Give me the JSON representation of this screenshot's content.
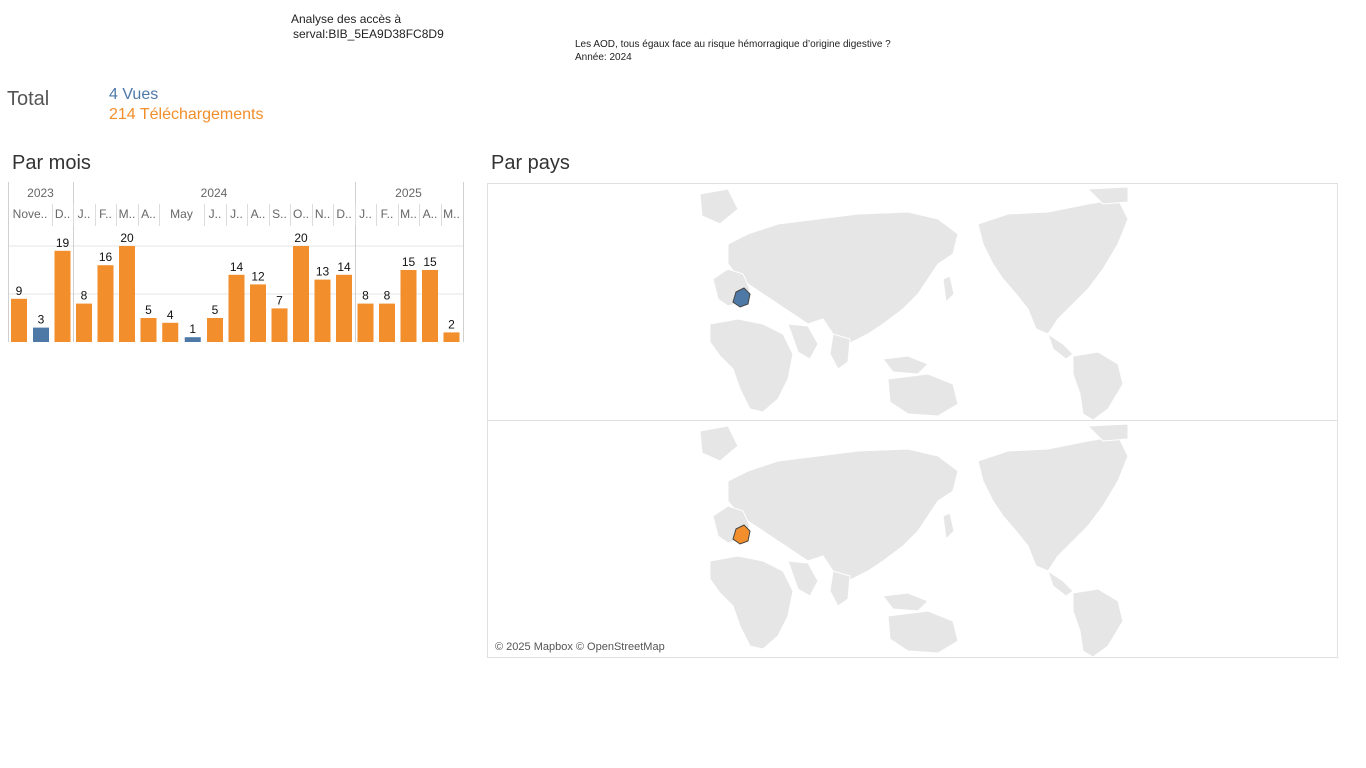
{
  "header": {
    "title_line1": "Analyse des accès à",
    "title_line2": "serval:BIB_5EA9D38FC8D9",
    "doc_title": "Les AOD, tous égaux face au risque hémorragique d’origine digestive ?",
    "doc_year": "Année: 2024"
  },
  "totals": {
    "label": "Total",
    "views": "4 Vues",
    "downloads": "214 Téléchargements"
  },
  "sections": {
    "by_month": "Par mois",
    "by_country": "Par pays"
  },
  "colors": {
    "views": "#4e79a7",
    "downloads": "#f28e2b",
    "grid": "#e6e6e6",
    "header_text": "#666666"
  },
  "chart_data": {
    "type": "bar",
    "title": "Par mois",
    "years": [
      {
        "label": "2023",
        "span": 2
      },
      {
        "label": "2024",
        "span": 12
      },
      {
        "label": "2025",
        "span": 5
      }
    ],
    "month_labels": [
      "Nove..",
      "D..",
      "J..",
      "F..",
      "M..",
      "A..",
      "May",
      "J..",
      "J..",
      "A..",
      "S..",
      "O..",
      "N..",
      "D..",
      "J..",
      "F..",
      "M..",
      "A..",
      "M.."
    ],
    "months": [
      {
        "bars": [
          {
            "series": "downloads",
            "value": 9
          },
          {
            "series": "views",
            "value": 3
          }
        ]
      },
      {
        "bars": [
          {
            "series": "downloads",
            "value": 19
          }
        ]
      },
      {
        "bars": [
          {
            "series": "downloads",
            "value": 8
          }
        ]
      },
      {
        "bars": [
          {
            "series": "downloads",
            "value": 16
          }
        ]
      },
      {
        "bars": [
          {
            "series": "downloads",
            "value": 20
          }
        ]
      },
      {
        "bars": [
          {
            "series": "downloads",
            "value": 5
          }
        ]
      },
      {
        "bars": [
          {
            "series": "downloads",
            "value": 4
          },
          {
            "series": "views",
            "value": 1
          }
        ]
      },
      {
        "bars": [
          {
            "series": "downloads",
            "value": 5
          }
        ]
      },
      {
        "bars": [
          {
            "series": "downloads",
            "value": 14
          }
        ]
      },
      {
        "bars": [
          {
            "series": "downloads",
            "value": 12
          }
        ]
      },
      {
        "bars": [
          {
            "series": "downloads",
            "value": 7
          }
        ]
      },
      {
        "bars": [
          {
            "series": "downloads",
            "value": 20
          }
        ]
      },
      {
        "bars": [
          {
            "series": "downloads",
            "value": 13
          }
        ]
      },
      {
        "bars": [
          {
            "series": "downloads",
            "value": 14
          }
        ]
      },
      {
        "bars": [
          {
            "series": "downloads",
            "value": 8
          }
        ]
      },
      {
        "bars": [
          {
            "series": "downloads",
            "value": 8
          }
        ]
      },
      {
        "bars": [
          {
            "series": "downloads",
            "value": 15
          }
        ]
      },
      {
        "bars": [
          {
            "series": "downloads",
            "value": 15
          }
        ]
      },
      {
        "bars": [
          {
            "series": "downloads",
            "value": 2
          }
        ]
      }
    ],
    "ylim": [
      0,
      20
    ],
    "grid": true,
    "legend": "none"
  },
  "maps": {
    "attribution": "© 2025 Mapbox © OpenStreetMap",
    "panels": [
      {
        "series": "views",
        "highlighted_country": "France"
      },
      {
        "series": "downloads",
        "highlighted_country": "France"
      }
    ]
  }
}
